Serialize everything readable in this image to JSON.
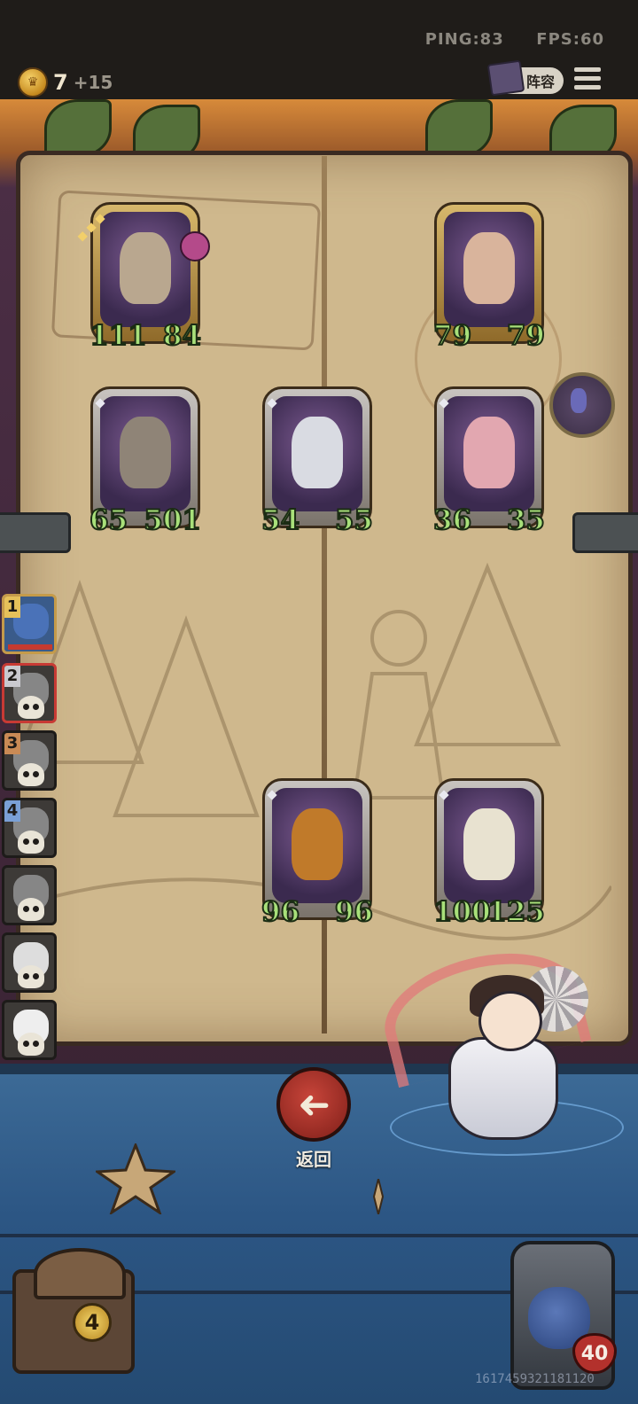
{
  "status": {
    "ping": "PING:83",
    "fps": "FPS:60"
  },
  "economy": {
    "gold": "7",
    "income": "+15"
  },
  "toolbar": {
    "lineup_label": "阵容"
  },
  "board": {
    "cards": [
      {
        "id": "knight-top-left",
        "attack": "111",
        "health": "84",
        "frame": "gold",
        "stars": 3,
        "has_status_icon": true
      },
      {
        "id": "girl-top-right",
        "attack": "79",
        "health": "79",
        "frame": "gold",
        "stars": 0
      },
      {
        "id": "viking",
        "attack": "65",
        "health": "501",
        "frame": "silver",
        "stars": 1
      },
      {
        "id": "paladin",
        "attack": "54",
        "health": "55",
        "frame": "silver",
        "stars": 1
      },
      {
        "id": "valkyrie",
        "attack": "36",
        "health": "35",
        "frame": "silver",
        "stars": 1
      },
      {
        "id": "pumpkin",
        "attack": "96",
        "health": "96",
        "frame": "silver",
        "stars": 1
      },
      {
        "id": "clockwork",
        "attack": "100",
        "health": "125",
        "frame": "silver",
        "stars": 1
      }
    ]
  },
  "sidebar": {
    "players": [
      {
        "rank": "1",
        "eliminated": false,
        "highlighted": false,
        "rank_color": "#e6c15a"
      },
      {
        "rank": "2",
        "eliminated": true,
        "highlighted": true,
        "rank_color": "#c9c9cf"
      },
      {
        "rank": "3",
        "eliminated": true,
        "highlighted": false,
        "rank_color": "#c98a55"
      },
      {
        "rank": "4",
        "eliminated": true,
        "highlighted": false,
        "rank_color": "#7aa0d6"
      },
      {
        "rank": "",
        "eliminated": true
      },
      {
        "rank": "",
        "eliminated": true
      },
      {
        "rank": "",
        "eliminated": true
      },
      {
        "rank": "",
        "eliminated": true
      }
    ]
  },
  "controls": {
    "return_label": "返回",
    "return_icon": "arrow-left-icon"
  },
  "shop": {
    "tavern_level": "4"
  },
  "player": {
    "health": "40"
  },
  "watermark": "1617459321181120",
  "colors": {
    "stat_green": "#a8e07a",
    "return_red": "#b23a30",
    "floor_blue": "#2c5684",
    "health_red": "#b3312c"
  }
}
